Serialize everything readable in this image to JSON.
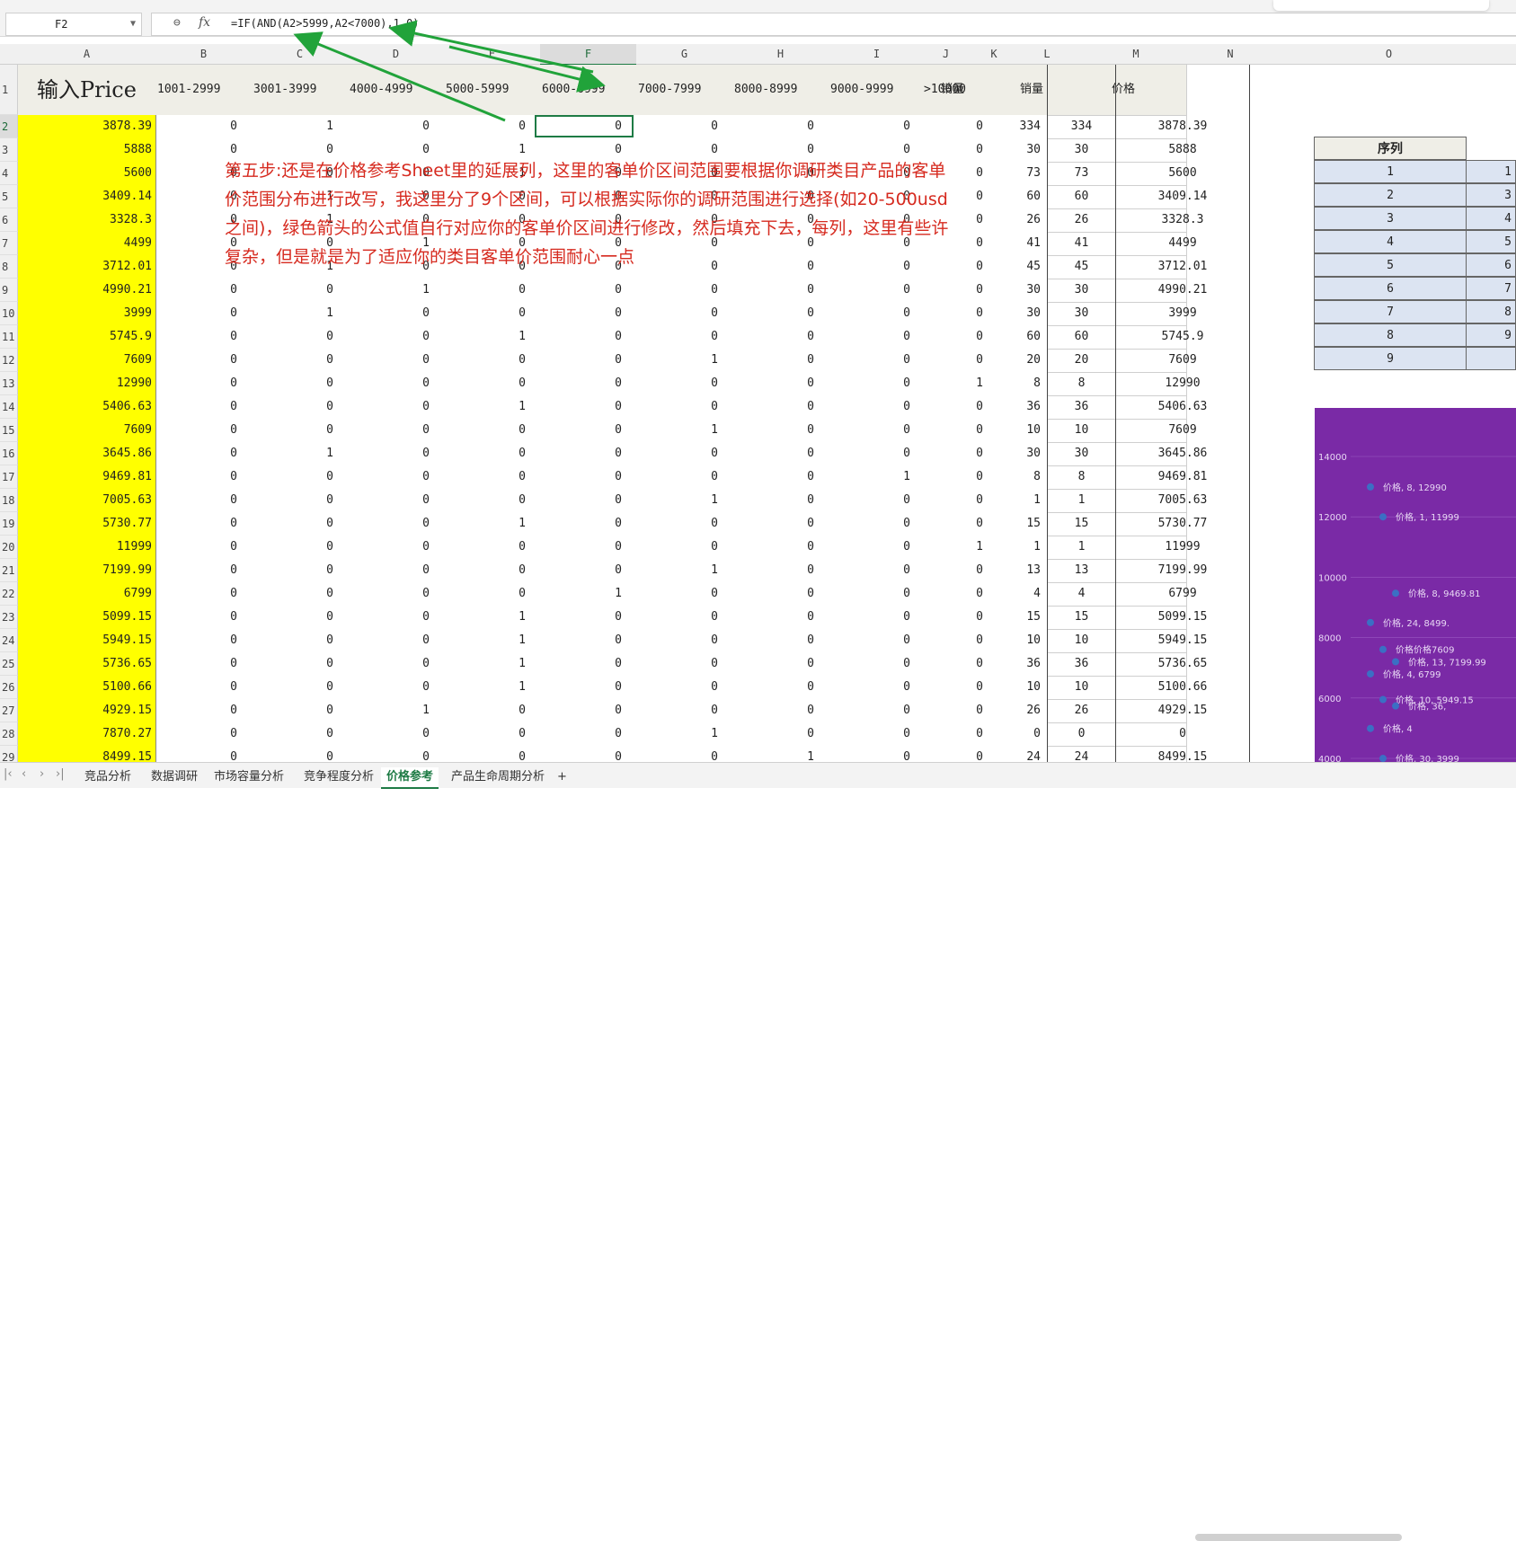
{
  "name_box": "F2",
  "formula_bar": {
    "fx": "fx",
    "formula": "=IF(AND(A2>5999,A2<7000),1,0)"
  },
  "columns": [
    "A",
    "B",
    "C",
    "D",
    "E",
    "F",
    "G",
    "H",
    "I",
    "J",
    "K",
    "L",
    "M",
    "N",
    "O"
  ],
  "selected_column": "F",
  "header_row": {
    "a": "输入Price",
    "ranges": [
      "1001-2999",
      "3001-3999",
      "4000-4999",
      "5000-5999",
      "6000-6999",
      "7000-7999",
      "8000-8999",
      "9000-9999",
      ">10000"
    ],
    "k": "销量",
    "l": "销量",
    "m": "价格"
  },
  "row_numbers": [
    "1",
    "2",
    "3",
    "4",
    "5",
    "6",
    "7",
    "8",
    "9",
    "10",
    "11",
    "12",
    "13",
    "14",
    "15",
    "16",
    "17",
    "18",
    "19",
    "20",
    "21",
    "22",
    "23",
    "24",
    "25",
    "26",
    "27",
    "28",
    "29"
  ],
  "rows": [
    {
      "a": "3878.39",
      "bins": [
        "0",
        "1",
        "0",
        "0",
        "0",
        "0",
        "0",
        "0",
        "0"
      ],
      "k": "334",
      "l": "334",
      "m": "3878.39"
    },
    {
      "a": "5888",
      "bins": [
        "0",
        "0",
        "0",
        "1",
        "0",
        "0",
        "0",
        "0",
        "0"
      ],
      "k": "30",
      "l": "30",
      "m": "5888"
    },
    {
      "a": "5600",
      "bins": [
        "0",
        "0",
        "0",
        "1",
        "0",
        "0",
        "0",
        "0",
        "0"
      ],
      "k": "73",
      "l": "73",
      "m": "5600"
    },
    {
      "a": "3409.14",
      "bins": [
        "0",
        "1",
        "0",
        "0",
        "0",
        "0",
        "0",
        "0",
        "0"
      ],
      "k": "60",
      "l": "60",
      "m": "3409.14"
    },
    {
      "a": "3328.3",
      "bins": [
        "0",
        "1",
        "0",
        "0",
        "0",
        "0",
        "0",
        "0",
        "0"
      ],
      "k": "26",
      "l": "26",
      "m": "3328.3"
    },
    {
      "a": "4499",
      "bins": [
        "0",
        "0",
        "1",
        "0",
        "0",
        "0",
        "0",
        "0",
        "0"
      ],
      "k": "41",
      "l": "41",
      "m": "4499"
    },
    {
      "a": "3712.01",
      "bins": [
        "0",
        "1",
        "0",
        "0",
        "0",
        "0",
        "0",
        "0",
        "0"
      ],
      "k": "45",
      "l": "45",
      "m": "3712.01"
    },
    {
      "a": "4990.21",
      "bins": [
        "0",
        "0",
        "1",
        "0",
        "0",
        "0",
        "0",
        "0",
        "0"
      ],
      "k": "30",
      "l": "30",
      "m": "4990.21"
    },
    {
      "a": "3999",
      "bins": [
        "0",
        "1",
        "0",
        "0",
        "0",
        "0",
        "0",
        "0",
        "0"
      ],
      "k": "30",
      "l": "30",
      "m": "3999"
    },
    {
      "a": "5745.9",
      "bins": [
        "0",
        "0",
        "0",
        "1",
        "0",
        "0",
        "0",
        "0",
        "0"
      ],
      "k": "60",
      "l": "60",
      "m": "5745.9"
    },
    {
      "a": "7609",
      "bins": [
        "0",
        "0",
        "0",
        "0",
        "0",
        "1",
        "0",
        "0",
        "0"
      ],
      "k": "20",
      "l": "20",
      "m": "7609"
    },
    {
      "a": "12990",
      "bins": [
        "0",
        "0",
        "0",
        "0",
        "0",
        "0",
        "0",
        "0",
        "1"
      ],
      "k": "8",
      "l": "8",
      "m": "12990"
    },
    {
      "a": "5406.63",
      "bins": [
        "0",
        "0",
        "0",
        "1",
        "0",
        "0",
        "0",
        "0",
        "0"
      ],
      "k": "36",
      "l": "36",
      "m": "5406.63"
    },
    {
      "a": "7609",
      "bins": [
        "0",
        "0",
        "0",
        "0",
        "0",
        "1",
        "0",
        "0",
        "0"
      ],
      "k": "10",
      "l": "10",
      "m": "7609"
    },
    {
      "a": "3645.86",
      "bins": [
        "0",
        "1",
        "0",
        "0",
        "0",
        "0",
        "0",
        "0",
        "0"
      ],
      "k": "30",
      "l": "30",
      "m": "3645.86"
    },
    {
      "a": "9469.81",
      "bins": [
        "0",
        "0",
        "0",
        "0",
        "0",
        "0",
        "0",
        "1",
        "0"
      ],
      "k": "8",
      "l": "8",
      "m": "9469.81"
    },
    {
      "a": "7005.63",
      "bins": [
        "0",
        "0",
        "0",
        "0",
        "0",
        "1",
        "0",
        "0",
        "0"
      ],
      "k": "1",
      "l": "1",
      "m": "7005.63"
    },
    {
      "a": "5730.77",
      "bins": [
        "0",
        "0",
        "0",
        "1",
        "0",
        "0",
        "0",
        "0",
        "0"
      ],
      "k": "15",
      "l": "15",
      "m": "5730.77"
    },
    {
      "a": "11999",
      "bins": [
        "0",
        "0",
        "0",
        "0",
        "0",
        "0",
        "0",
        "0",
        "1"
      ],
      "k": "1",
      "l": "1",
      "m": "11999"
    },
    {
      "a": "7199.99",
      "bins": [
        "0",
        "0",
        "0",
        "0",
        "0",
        "1",
        "0",
        "0",
        "0"
      ],
      "k": "13",
      "l": "13",
      "m": "7199.99"
    },
    {
      "a": "6799",
      "bins": [
        "0",
        "0",
        "0",
        "0",
        "1",
        "0",
        "0",
        "0",
        "0"
      ],
      "k": "4",
      "l": "4",
      "m": "6799"
    },
    {
      "a": "5099.15",
      "bins": [
        "0",
        "0",
        "0",
        "1",
        "0",
        "0",
        "0",
        "0",
        "0"
      ],
      "k": "15",
      "l": "15",
      "m": "5099.15"
    },
    {
      "a": "5949.15",
      "bins": [
        "0",
        "0",
        "0",
        "1",
        "0",
        "0",
        "0",
        "0",
        "0"
      ],
      "k": "10",
      "l": "10",
      "m": "5949.15"
    },
    {
      "a": "5736.65",
      "bins": [
        "0",
        "0",
        "0",
        "1",
        "0",
        "0",
        "0",
        "0",
        "0"
      ],
      "k": "36",
      "l": "36",
      "m": "5736.65"
    },
    {
      "a": "5100.66",
      "bins": [
        "0",
        "0",
        "0",
        "1",
        "0",
        "0",
        "0",
        "0",
        "0"
      ],
      "k": "10",
      "l": "10",
      "m": "5100.66"
    },
    {
      "a": "4929.15",
      "bins": [
        "0",
        "0",
        "1",
        "0",
        "0",
        "0",
        "0",
        "0",
        "0"
      ],
      "k": "26",
      "l": "26",
      "m": "4929.15"
    },
    {
      "a": "7870.27",
      "bins": [
        "0",
        "0",
        "0",
        "0",
        "0",
        "1",
        "0",
        "0",
        "0"
      ],
      "k": "0",
      "l": "0",
      "m": "0"
    },
    {
      "a": "8499.15",
      "bins": [
        "0",
        "0",
        "0",
        "0",
        "0",
        "0",
        "1",
        "0",
        "0"
      ],
      "k": "24",
      "l": "24",
      "m": "8499.15"
    }
  ],
  "annotation": "第五步:还是在价格参考Sheet里的延展列，这里的客单价区间范围要根据你调研类目产品的客单价范围分布进行改写，我这里分了9个区间，可以根据实际你的调研范围进行选择(如20-500usd之间)，绿色箭头的公式值自行对应你的客单价区间进行修改，然后填充下去，每列，这里有些许复杂，但是就是为了适应你的类目客单价范围耐心一点",
  "seq_table": {
    "header": "序列",
    "rows": [
      {
        "seq": "1",
        "val": "1"
      },
      {
        "seq": "2",
        "val": "3"
      },
      {
        "seq": "3",
        "val": "4"
      },
      {
        "seq": "4",
        "val": "5"
      },
      {
        "seq": "5",
        "val": "6"
      },
      {
        "seq": "6",
        "val": "7"
      },
      {
        "seq": "7",
        "val": "8"
      },
      {
        "seq": "8",
        "val": "9"
      },
      {
        "seq": "9",
        "val": ""
      }
    ]
  },
  "chart_data": {
    "type": "scatter",
    "yticks": [
      "14000",
      "12000",
      "10000",
      "8000",
      "6000",
      "4000"
    ],
    "ylim": [
      4000,
      14000
    ],
    "points": [
      {
        "label": "价格, 8, 12990",
        "y": 12990
      },
      {
        "label": "价格, 1, 11999",
        "y": 11999
      },
      {
        "label": "价格, 8, 9469.81",
        "y": 9469.81
      },
      {
        "label": "价格, 24, 8499.",
        "y": 8499.15
      },
      {
        "label": "价格价格7609",
        "y": 7609
      },
      {
        "label": "价格, 13, 7199.99",
        "y": 7199.99
      },
      {
        "label": "价格, 4, 6799",
        "y": 6799
      },
      {
        "label": "价格, 10, 5949.15",
        "y": 5949.15
      },
      {
        "label": "价格, 36,",
        "y": 5736.65
      },
      {
        "label": "价格, 4",
        "y": 4990.21
      },
      {
        "label": "价格, 30, 3999",
        "y": 3999
      }
    ],
    "bg_color": "#7a2aa6",
    "point_color": "#3b6fc4"
  },
  "sheet_tabs": [
    "竞品分析",
    "数据调研",
    "市场容量分析",
    "竞争程度分析",
    "价格参考",
    "产品生命周期分析"
  ],
  "active_tab": "价格参考",
  "add_tab": "+"
}
